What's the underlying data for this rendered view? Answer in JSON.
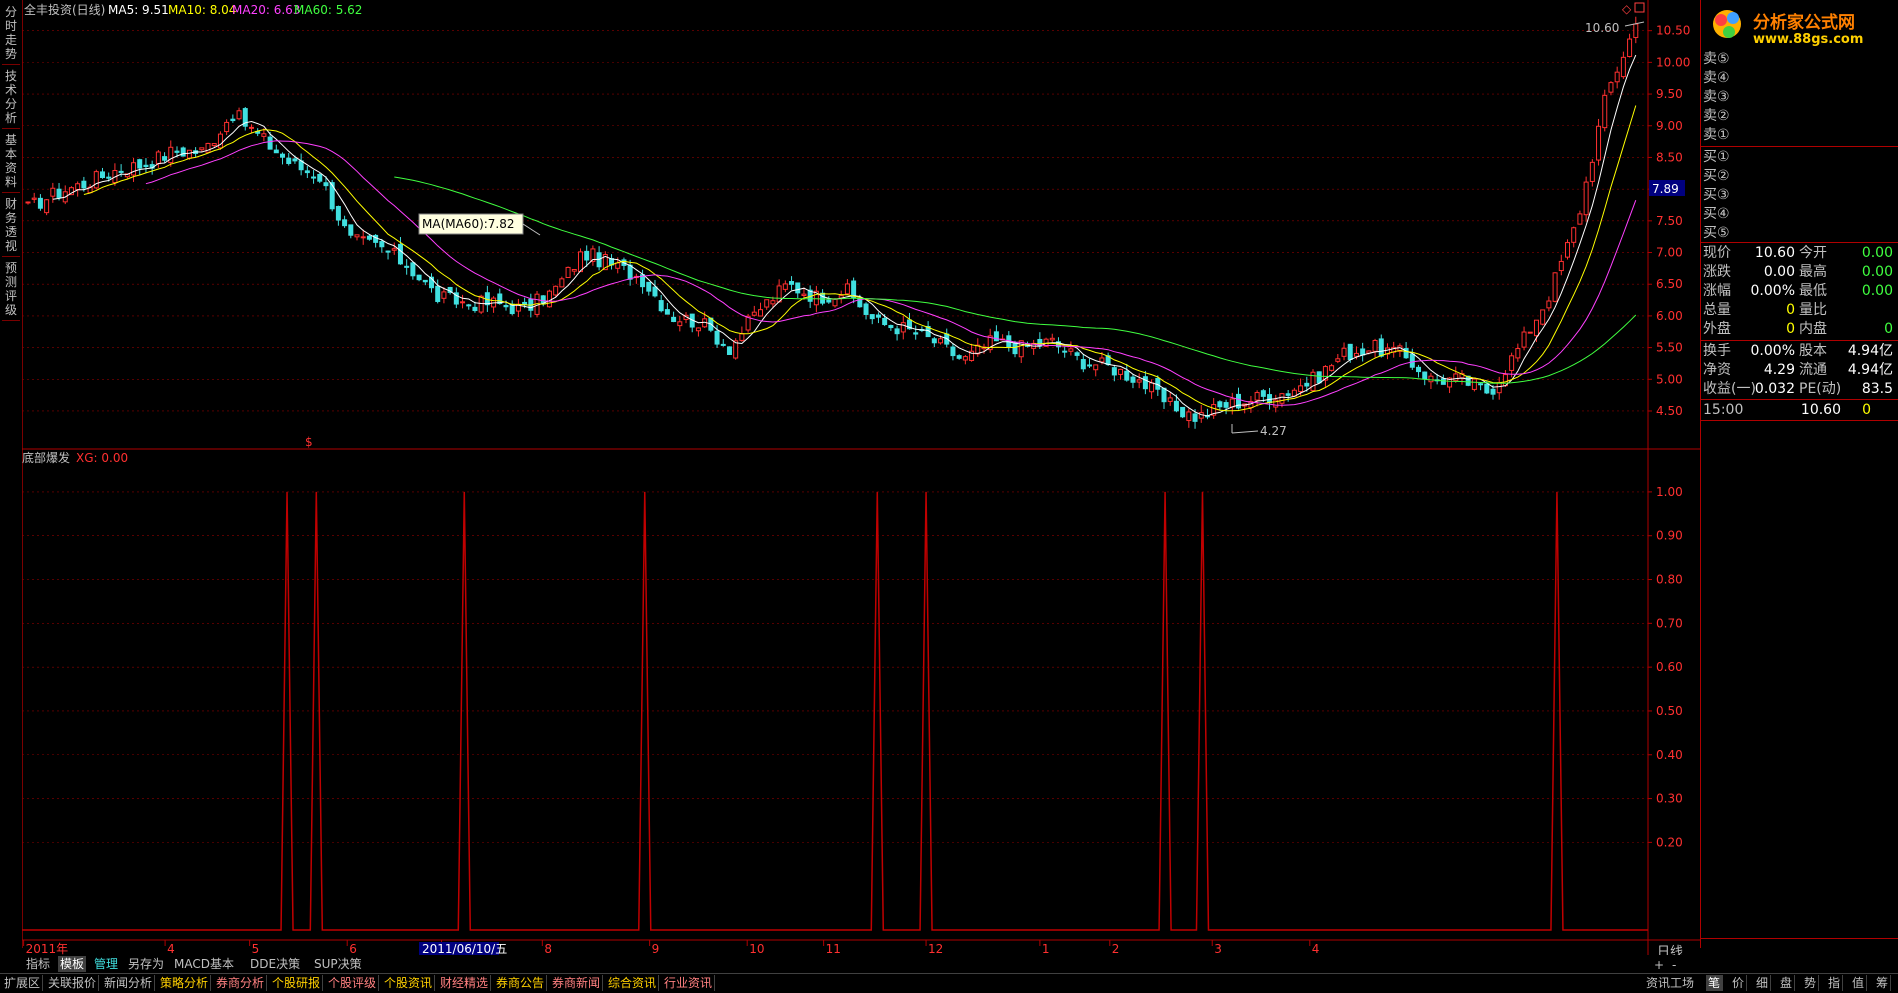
{
  "colors": {
    "up": "#ff3030",
    "down": "#40e0e0",
    "ma5": "#ffffff",
    "ma10": "#ffff00",
    "ma20": "#ff40ff",
    "ma60": "#40ff40",
    "grid": "#8b0000",
    "axis": "#b00000",
    "signal": "#c00000"
  },
  "header": {
    "title": "全丰投资(日线)",
    "ma5": "MA5: 9.51",
    "ma10": "MA10: 8.04",
    "ma20": "MA20: 6.63",
    "ma60": "MA60: 5.62"
  },
  "left_tabs": [
    "分时走势",
    "技术分析",
    "基本资料",
    "财务透视",
    "预测评级"
  ],
  "logo": {
    "text": "分析家公式网",
    "url": "www.88gs.com"
  },
  "tooltip": "MA(MA60):7.82",
  "price_labels": {
    "high": "10.60",
    "low": "4.27",
    "current": "7.89"
  },
  "signal_marker": "$",
  "indicator": {
    "name": "底部爆发",
    "xg": "XG: 0.00"
  },
  "chart_data": [
    {
      "type": "candlestick",
      "title": "全丰投资(日线)",
      "ylim": [
        4.2,
        10.7
      ],
      "y_ticks": [
        "10.50",
        "10.00",
        "9.50",
        "9.00",
        "8.50",
        "8.00",
        "7.50",
        "7.00",
        "6.50",
        "6.00",
        "5.50",
        "5.00",
        "4.50"
      ],
      "x_labels": [
        "2011年",
        "4",
        "5",
        "6",
        "7",
        "8",
        "9",
        "10",
        "11",
        "12",
        "1",
        "2",
        "3",
        "4"
      ],
      "cursor_date": "2011/06/10/五",
      "series": [
        {
          "name": "MA5",
          "value": 9.51
        },
        {
          "name": "MA10",
          "value": 8.04
        },
        {
          "name": "MA20",
          "value": 6.63
        },
        {
          "name": "MA60",
          "value": 5.62
        }
      ],
      "close_path": [
        7.7,
        7.95,
        8.1,
        8.3,
        8.4,
        8.6,
        8.6,
        9.2,
        8.8,
        8.4,
        8.2,
        7.2,
        7.1,
        6.8,
        6.3,
        6.2,
        6.2,
        6.1,
        6.4,
        7.0,
        6.8,
        6.6,
        6.0,
        5.9,
        5.5,
        6.1,
        6.5,
        6.3,
        6.4,
        5.9,
        5.8,
        5.6,
        5.3,
        5.6,
        5.5,
        5.6,
        5.3,
        5.2,
        5.0,
        4.6,
        4.4,
        4.6,
        4.7,
        4.8,
        5.0,
        5.4,
        5.5,
        5.4,
        5.0,
        5.0,
        4.8,
        5.5,
        6.3,
        7.5,
        9.5,
        10.6
      ]
    },
    {
      "type": "line",
      "title": "底部爆发",
      "ylim": [
        0,
        1.05
      ],
      "y_ticks": [
        "1.00",
        "0.90",
        "0.80",
        "0.70",
        "0.60",
        "0.50",
        "0.40",
        "0.30",
        "0.20"
      ],
      "signal_positions": [
        0.163,
        0.181,
        0.272,
        0.383,
        0.526,
        0.556,
        0.703,
        0.726,
        0.944
      ],
      "values": [
        1,
        1,
        1,
        1,
        1,
        1,
        1,
        1,
        1
      ]
    }
  ],
  "right_panel": {
    "asks": [
      "卖⑤",
      "卖④",
      "卖③",
      "卖②",
      "卖①"
    ],
    "bids": [
      "买①",
      "买②",
      "买③",
      "买④",
      "买⑤"
    ],
    "quote_rows": [
      {
        "l1": "现价",
        "v1": "10.60",
        "l2": "今开",
        "v2": "0.00"
      },
      {
        "l1": "涨跌",
        "v1": "0.00",
        "l2": "最高",
        "v2": "0.00"
      },
      {
        "l1": "涨幅",
        "v1": "0.00%",
        "l2": "最低",
        "v2": "0.00"
      },
      {
        "l1": "总量",
        "v1": "0",
        "l2": "量比",
        "v2": ""
      },
      {
        "l1": "外盘",
        "v1": "0",
        "l2": "内盘",
        "v2": "0"
      }
    ],
    "fund_rows": [
      {
        "l1": "换手",
        "v1": "0.00%",
        "l2": "股本",
        "v2": "4.94亿"
      },
      {
        "l1": "净资",
        "v1": "4.29",
        "l2": "流通",
        "v2": "4.94亿"
      },
      {
        "l1": "收益(一)",
        "v1": "0.032",
        "l2": "PE(动)",
        "v2": "83.5"
      }
    ],
    "tick": {
      "time": "15:00",
      "price": "10.60",
      "vol": "0"
    },
    "period": "日线"
  },
  "bottom_tabs_1": [
    "指标",
    "模板",
    "管理",
    "另存为",
    "MACD基本",
    "DDE决策",
    "SUP决策"
  ],
  "bottom_tabs_2": [
    "扩展区",
    "关联报价",
    "新闻分析",
    "策略分析",
    "券商分析",
    "个股研报",
    "个股评级",
    "个股资讯",
    "财经精选",
    "券商公告",
    "券商新闻",
    "综合资讯",
    "行业资讯"
  ],
  "bottom_right": {
    "label": "资讯工场",
    "plus": "+",
    "minus": "-",
    "icons": [
      "笔",
      "价",
      "细",
      "盘",
      "势",
      "指",
      "值",
      "筹"
    ]
  }
}
